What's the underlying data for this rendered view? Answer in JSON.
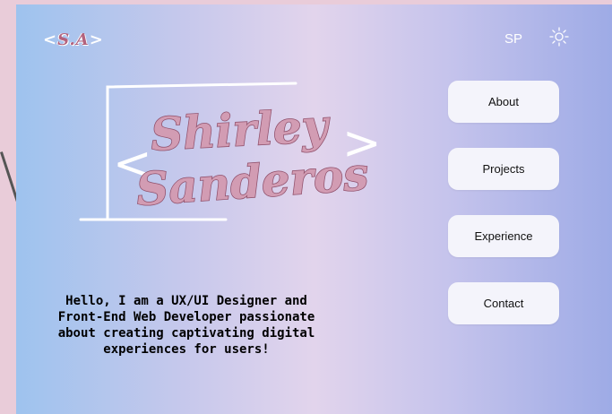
{
  "header": {
    "logo_left": "<",
    "logo_mark": "S.A",
    "logo_right": ">",
    "initials": "SP",
    "theme_icon": "sun-icon"
  },
  "hero": {
    "name_first": "Shirley",
    "name_last": "Sanderos",
    "bracket_left": "<",
    "bracket_right": ">",
    "intro": "Hello, I am a UX/UI Designer and Front-End Web Developer passionate about creating captivating digital experiences for users!"
  },
  "nav": {
    "items": [
      {
        "label": "About"
      },
      {
        "label": "Projects"
      },
      {
        "label": "Experience"
      },
      {
        "label": "Contact"
      }
    ]
  },
  "colors": {
    "background": "#e9ccd9",
    "gradient_left": "#9ec3ee",
    "gradient_mid": "#e2d4ec",
    "gradient_right": "#9eabe6",
    "name_fill": "#d29cb3",
    "name_stroke": "#8f4f6a",
    "button_bg": "#f4f4fb"
  }
}
